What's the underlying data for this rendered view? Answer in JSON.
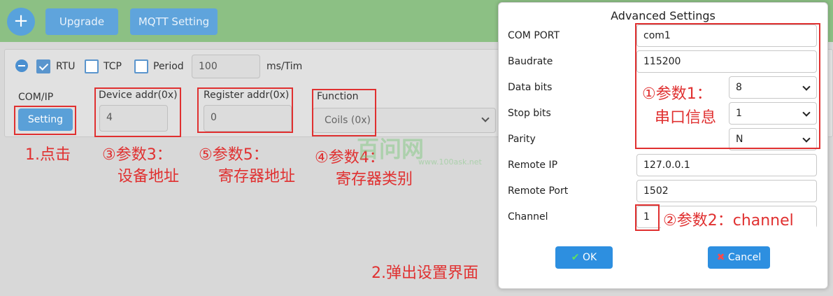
{
  "toolbar": {
    "add_icon": "plus-icon",
    "upgrade_label": "Upgrade",
    "mqtt_label": "MQTT Setting"
  },
  "options": {
    "rtu_label": "RTU",
    "rtu_checked": true,
    "tcp_label": "TCP",
    "tcp_checked": false,
    "period_label": "Period",
    "period_checked": false,
    "period_value": "100",
    "period_unit": "ms/Tim"
  },
  "device": {
    "comip_label": "COM/IP",
    "setting_label": "Setting",
    "device_addr_label": "Device addr(0x)",
    "device_addr_value": "4",
    "register_addr_label": "Register addr(0x)",
    "register_addr_value": "0",
    "function_label": "Function",
    "function_value": "Coils (0x)"
  },
  "annotations": {
    "a1": "1.点击",
    "a3_line1": "③参数3：",
    "a3_line2": "设备地址",
    "a5_line1": "⑤参数5：",
    "a5_line2": "寄存器地址",
    "a4_line1": "④参数4：",
    "a4_line2": "寄存器类别",
    "a2_popup": "2.弹出设置界面",
    "p1_line1": "①参数1：",
    "p1_line2": "串口信息",
    "p2": "②参数2：channel"
  },
  "watermark": {
    "logo_text": "百问网",
    "url": "www.100ask.net"
  },
  "dialog": {
    "title": "Advanced Settings",
    "com_port_label": "COM PORT",
    "com_port_value": "com1",
    "baudrate_label": "Baudrate",
    "baudrate_value": "115200",
    "data_bits_label": "Data bits",
    "data_bits_value": "8",
    "stop_bits_label": "Stop bits",
    "stop_bits_value": "1",
    "parity_label": "Parity",
    "parity_value": "N",
    "remote_ip_label": "Remote IP",
    "remote_ip_value": "127.0.0.1",
    "remote_port_label": "Remote Port",
    "remote_port_value": "1502",
    "channel_label": "Channel",
    "channel_value": "1",
    "ok_label": "OK",
    "cancel_label": "Cancel"
  },
  "colors": {
    "toolbar": "#8cc084",
    "accent": "#5aa0d8",
    "annotation": "#e03030"
  }
}
